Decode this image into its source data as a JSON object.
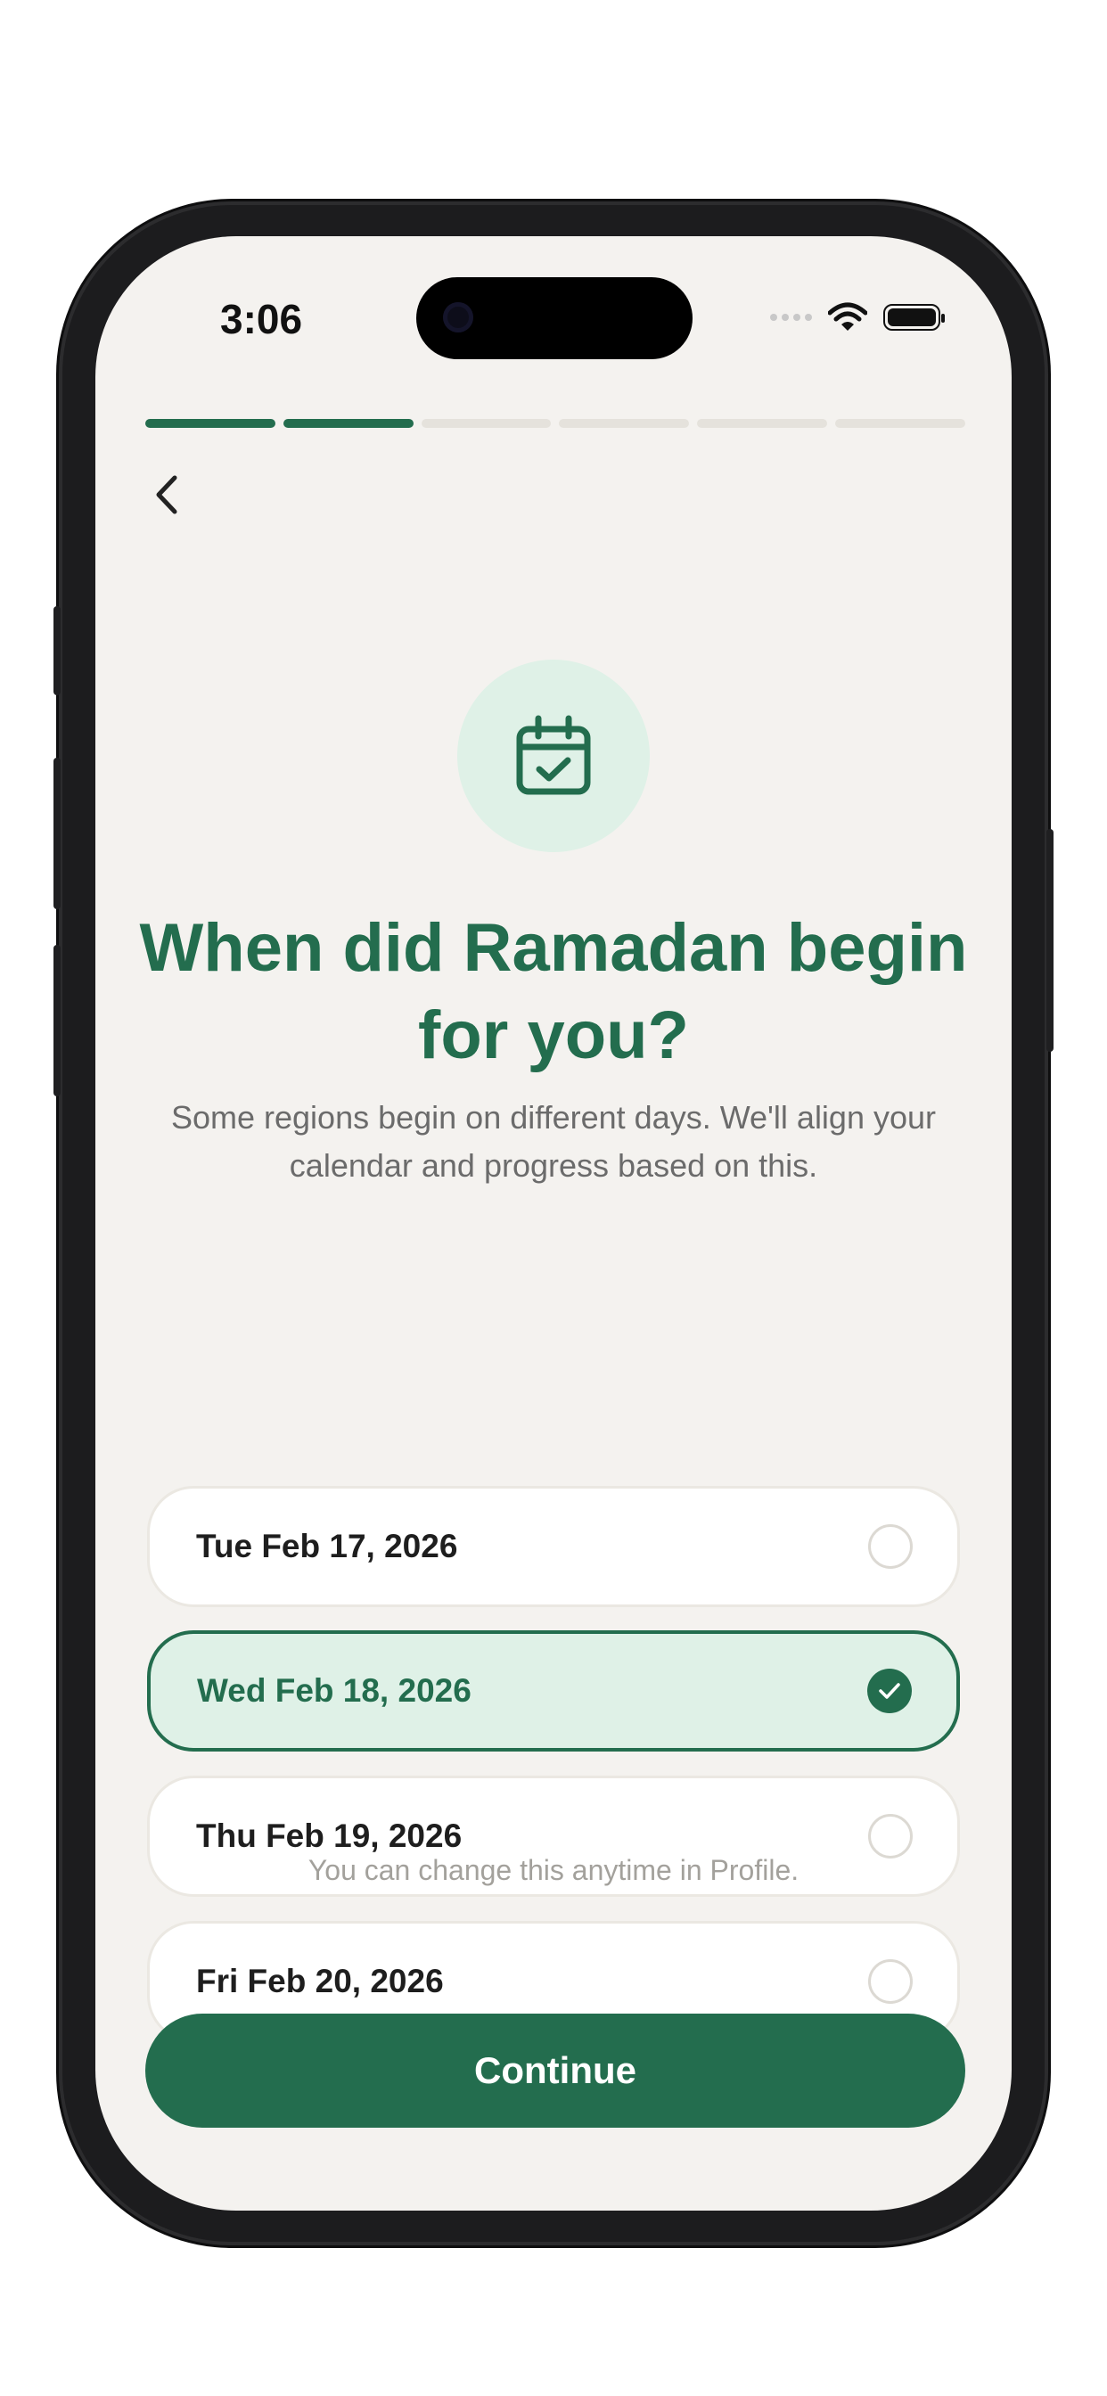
{
  "status_bar": {
    "time": "3:06"
  },
  "onboarding": {
    "progress": {
      "total_steps": 6,
      "completed_steps": 2
    },
    "title": "When did Ramadan begin for you?",
    "subtitle": "Some regions begin on different days. We'll align your calendar and progress based on this.",
    "options": [
      {
        "label": "Tue Feb 17, 2026",
        "selected": false
      },
      {
        "label": "Wed Feb 18, 2026",
        "selected": true
      },
      {
        "label": "Thu Feb 19, 2026",
        "selected": false
      },
      {
        "label": "Fri Feb 20, 2026",
        "selected": false
      }
    ],
    "footnote": "You can change this anytime in Profile.",
    "continue_label": "Continue"
  },
  "colors": {
    "accent": "#236d4e",
    "accent_light": "#dff1e7",
    "background": "#f4f2ef"
  },
  "icons": {
    "back": "chevron-left-icon",
    "header": "calendar-check-icon",
    "selected": "checkmark-icon"
  }
}
